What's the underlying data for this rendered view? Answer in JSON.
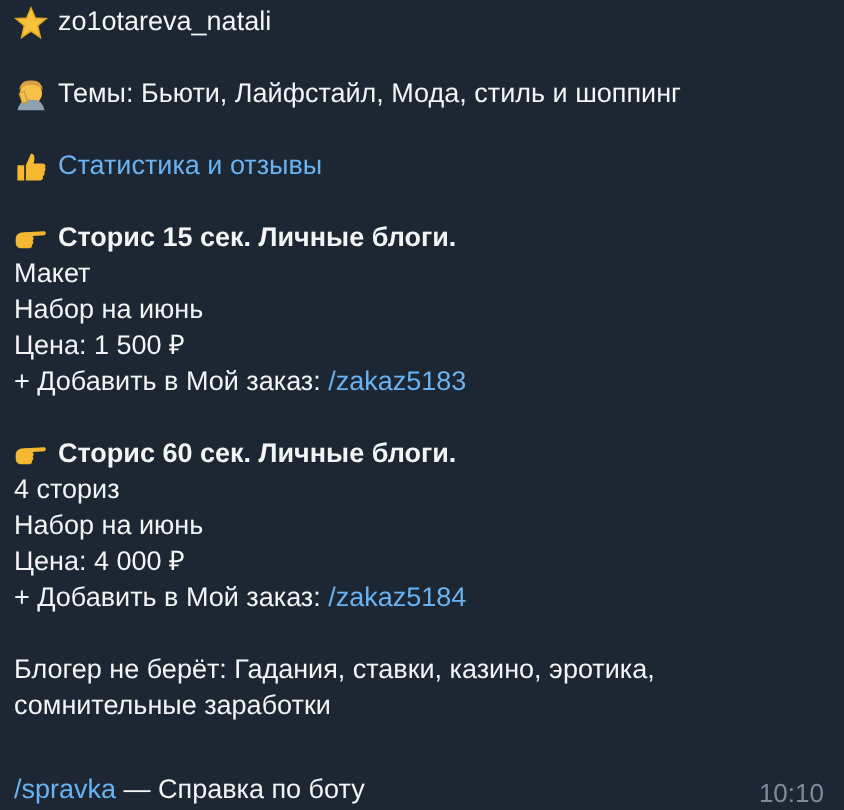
{
  "message": {
    "blocks": [
      {
        "lines": [
          {
            "kind": "author",
            "parts": [
              {
                "text": "zo1otareva_natali",
                "link": false
              }
            ]
          }
        ]
      },
      {
        "lines": [
          {
            "kind": "topics",
            "parts": [
              {
                "text": "Темы: Бьюти, Лайфстайл, Мода, стиль и шоппинг",
                "link": false
              }
            ]
          }
        ]
      },
      {
        "lines": [
          {
            "kind": "stats",
            "parts": [
              {
                "text": "Статистика и отзывы",
                "link": true
              }
            ]
          }
        ]
      },
      {
        "lines": [
          {
            "kind": "offer-title",
            "parts": [
              {
                "text": "Сторис 15 сек. Личные блоги.",
                "link": false
              }
            ]
          },
          {
            "kind": "text",
            "parts": [
              {
                "text": "Макет",
                "link": false
              }
            ]
          },
          {
            "kind": "text",
            "parts": [
              {
                "text": "Набор на июнь",
                "link": false
              }
            ]
          },
          {
            "kind": "text",
            "parts": [
              {
                "text": "Цена: 1 500 ₽",
                "link": false
              }
            ]
          },
          {
            "kind": "text",
            "parts": [
              {
                "text": "+ Добавить в Мой заказ: ",
                "link": false
              },
              {
                "text": "/zakaz5183",
                "link": true
              }
            ]
          }
        ]
      },
      {
        "lines": [
          {
            "kind": "offer-title",
            "parts": [
              {
                "text": "Сторис 60 сек. Личные блоги.",
                "link": false
              }
            ]
          },
          {
            "kind": "text",
            "parts": [
              {
                "text": "4 сториз",
                "link": false
              }
            ]
          },
          {
            "kind": "text",
            "parts": [
              {
                "text": "Набор на июнь",
                "link": false
              }
            ]
          },
          {
            "kind": "text",
            "parts": [
              {
                "text": "Цена: 4 000 ₽",
                "link": false
              }
            ]
          },
          {
            "kind": "text",
            "parts": [
              {
                "text": "+ Добавить в Мой заказ: ",
                "link": false
              },
              {
                "text": "/zakaz5184",
                "link": true
              }
            ]
          }
        ]
      },
      {
        "lines": [
          {
            "kind": "text",
            "parts": [
              {
                "text": "Блогер не берёт: Гадания, ставки, казино, эротика, сомнительные заработки",
                "link": false
              }
            ]
          }
        ]
      },
      {
        "lines": [
          {
            "kind": "text",
            "parts": [
              {
                "text": "/spravka",
                "link": true
              },
              {
                "text": " — Справка по боту",
                "link": false
              }
            ]
          }
        ]
      }
    ],
    "time": "10:10"
  }
}
